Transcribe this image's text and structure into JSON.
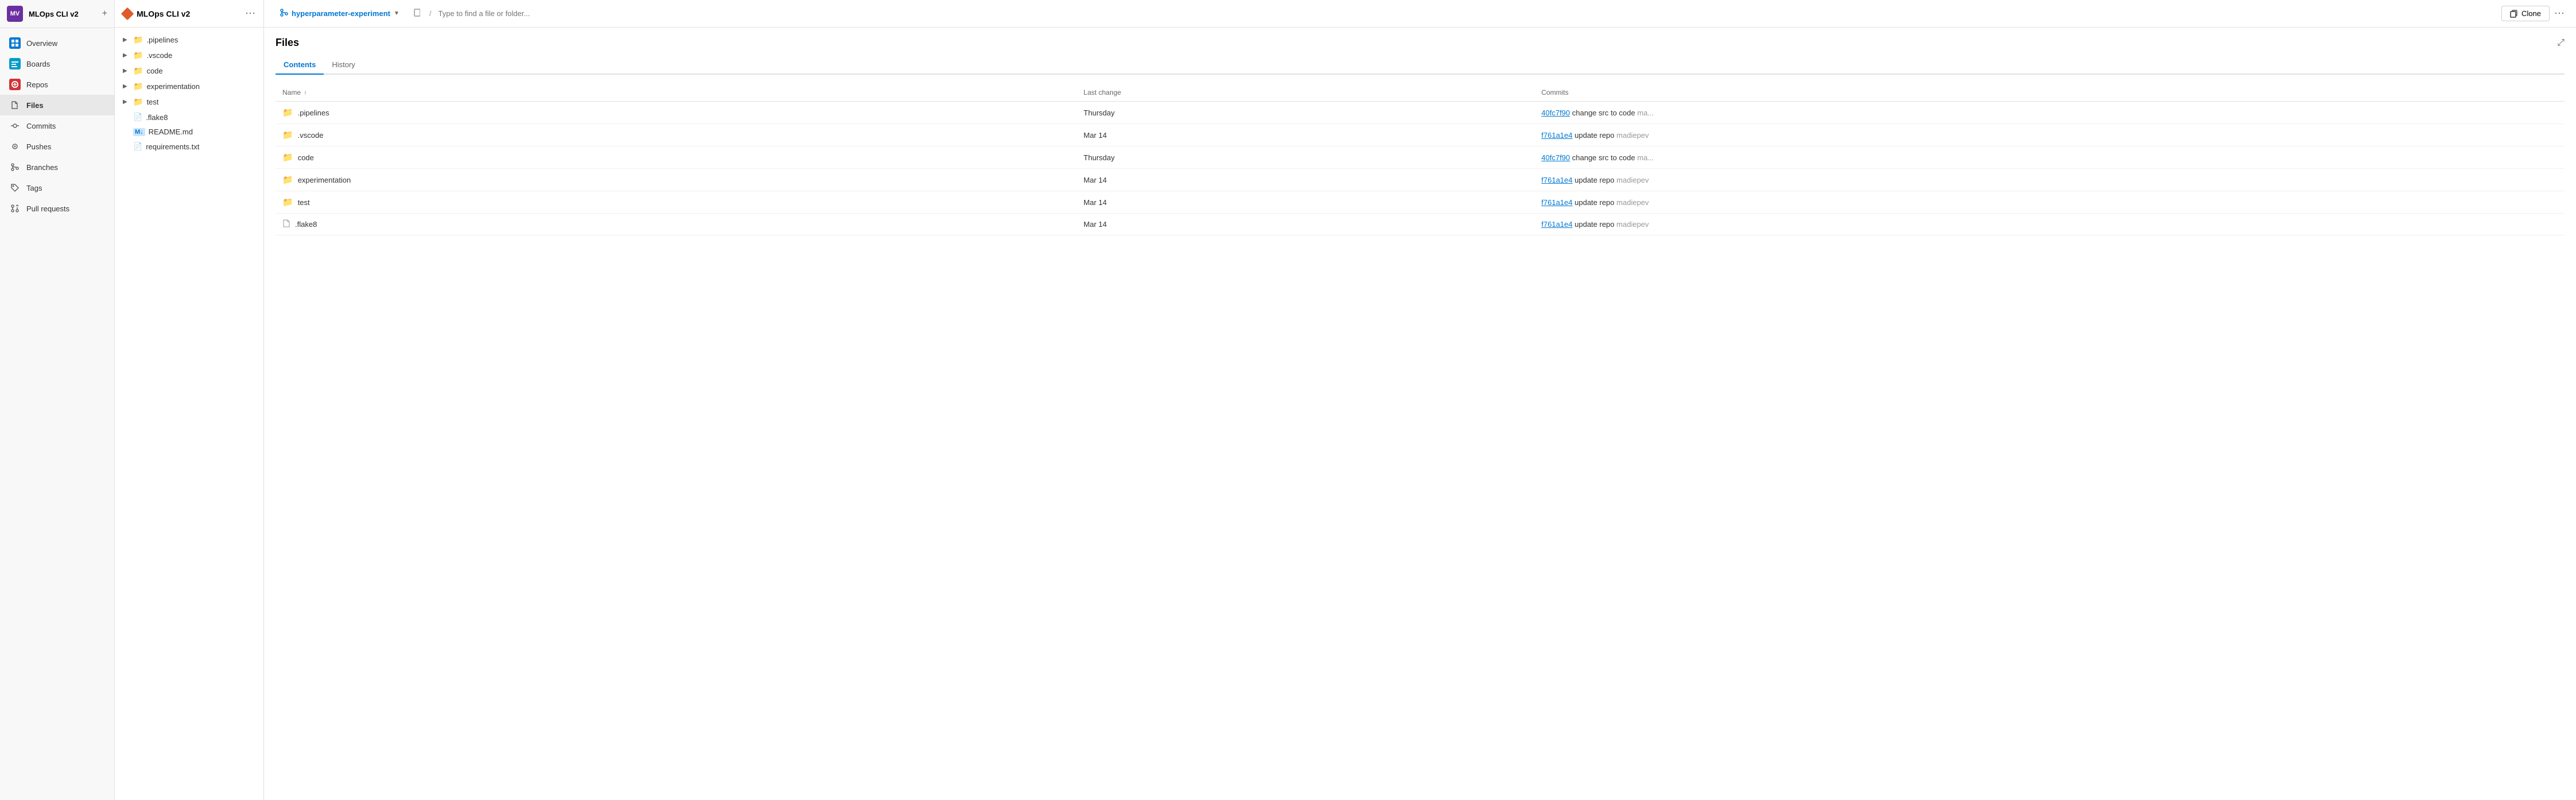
{
  "app": {
    "avatar": "MV",
    "title": "MLOps CLI v2",
    "plus_label": "+"
  },
  "nav": {
    "items": [
      {
        "id": "overview",
        "label": "Overview",
        "icon": "overview",
        "active": false
      },
      {
        "id": "boards",
        "label": "Boards",
        "icon": "boards",
        "active": false
      },
      {
        "id": "repos",
        "label": "Repos",
        "icon": "repos",
        "active": false
      },
      {
        "id": "files",
        "label": "Files",
        "icon": "files",
        "active": true
      },
      {
        "id": "commits",
        "label": "Commits",
        "icon": "commits",
        "active": false
      },
      {
        "id": "pushes",
        "label": "Pushes",
        "icon": "pushes",
        "active": false
      },
      {
        "id": "branches",
        "label": "Branches",
        "icon": "branches",
        "active": false
      },
      {
        "id": "tags",
        "label": "Tags",
        "icon": "tags",
        "active": false
      },
      {
        "id": "pull-requests",
        "label": "Pull requests",
        "icon": "prs",
        "active": false
      }
    ]
  },
  "middle": {
    "title": "MLOps CLI v2",
    "tree": [
      {
        "type": "folder",
        "name": ".pipelines",
        "collapsed": true
      },
      {
        "type": "folder",
        "name": ".vscode",
        "collapsed": true
      },
      {
        "type": "folder",
        "name": "code",
        "collapsed": true
      },
      {
        "type": "folder",
        "name": "experimentation",
        "collapsed": true
      },
      {
        "type": "folder",
        "name": "test",
        "collapsed": true
      },
      {
        "type": "file",
        "name": ".flake8"
      },
      {
        "type": "md",
        "name": "README.md"
      },
      {
        "type": "file",
        "name": "requirements.txt"
      }
    ]
  },
  "main": {
    "branch": "hyperparameter-experiment",
    "path_placeholder": "Type to find a file or folder...",
    "title": "Files",
    "clone_label": "Clone",
    "more_label": "⋯",
    "tabs": [
      {
        "id": "contents",
        "label": "Contents",
        "active": true
      },
      {
        "id": "history",
        "label": "History",
        "active": false
      }
    ],
    "table": {
      "columns": [
        {
          "id": "name",
          "label": "Name",
          "sort": "↑"
        },
        {
          "id": "last_change",
          "label": "Last change"
        },
        {
          "id": "commits",
          "label": "Commits"
        }
      ],
      "rows": [
        {
          "type": "folder",
          "name": ".pipelines",
          "last_change": "Thursday",
          "commit_hash": "40fc7f90",
          "commit_msg": "change src to code",
          "commit_suffix": "ma...",
          "author": ""
        },
        {
          "type": "folder",
          "name": ".vscode",
          "last_change": "Mar 14",
          "commit_hash": "f761a1e4",
          "commit_msg": "update repo",
          "commit_suffix": "",
          "author": "madiepev"
        },
        {
          "type": "folder",
          "name": "code",
          "last_change": "Thursday",
          "commit_hash": "40fc7f90",
          "commit_msg": "change src to code",
          "commit_suffix": "ma...",
          "author": ""
        },
        {
          "type": "folder",
          "name": "experimentation",
          "last_change": "Mar 14",
          "commit_hash": "f761a1e4",
          "commit_msg": "update repo",
          "commit_suffix": "",
          "author": "madiepev"
        },
        {
          "type": "folder",
          "name": "test",
          "last_change": "Mar 14",
          "commit_hash": "f761a1e4",
          "commit_msg": "update repo",
          "commit_suffix": "",
          "author": "madiepev"
        },
        {
          "type": "file",
          "name": ".flake8",
          "last_change": "Mar 14",
          "commit_hash": "f761a1e4",
          "commit_msg": "update repo",
          "commit_suffix": "",
          "author": "madiepev"
        }
      ]
    }
  }
}
